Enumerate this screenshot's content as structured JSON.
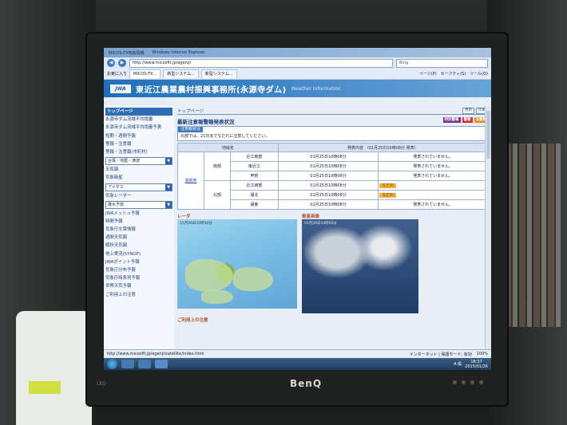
{
  "browser": {
    "tab_title": "MICOS-FX気象情報",
    "window_label": "Windows Internet Explorer",
    "url": "http://www.micosfit.jp/egenji/",
    "search_engine": "Bing",
    "favorites_label": "お気に入り",
    "fav_tabs": [
      "MICOS-FX...",
      "新型システム...",
      "新型システム..."
    ],
    "commands": [
      "ページ(P)",
      "セーフティ(S)",
      "ツール(O)"
    ]
  },
  "site": {
    "logo": "JWA",
    "title": "東近江農業農村振興事務所(永源寺ダム)",
    "subtitle": "Weather Information"
  },
  "sidebar": {
    "items": [
      {
        "label": "トップページ",
        "type": "head"
      },
      {
        "label": "永源寺ダム流域平均雨量",
        "type": "link"
      },
      {
        "label": "永源寺ダム流域平均雨量予測",
        "type": "link"
      },
      {
        "label": "短期・週間予報",
        "type": "link"
      },
      {
        "label": "警報・注意報",
        "type": "link"
      },
      {
        "label": "警報・注意報(市町村)",
        "type": "link"
      },
      {
        "label": "台風・地震・津波",
        "type": "select"
      },
      {
        "label": "天気図",
        "type": "link"
      },
      {
        "label": "気象衛星",
        "type": "link"
      },
      {
        "label": "アメダス",
        "type": "select"
      },
      {
        "label": "気象レーダー",
        "type": "link"
      },
      {
        "label": "降水予測",
        "type": "select"
      },
      {
        "label": "JWAメッシュ予報",
        "type": "link"
      },
      {
        "label": "時間予報",
        "type": "link"
      },
      {
        "label": "気象庁文章情報",
        "type": "link"
      },
      {
        "label": "週間天気図",
        "type": "link"
      },
      {
        "label": "解析天気図",
        "type": "link"
      },
      {
        "label": "地上実況(SYNOP)",
        "type": "link"
      },
      {
        "label": "JWAポイント予報",
        "type": "link"
      },
      {
        "label": "気象庁分布予報",
        "type": "link"
      },
      {
        "label": "気象庁時系列予報",
        "type": "link"
      },
      {
        "label": "世界天気予報",
        "type": "link"
      },
      {
        "label": "ご利用上の注意",
        "type": "link"
      }
    ]
  },
  "main": {
    "breadcrumb": "トップページ",
    "mini_buttons": [
      "更新",
      "印刷"
    ],
    "section_title": "最新注意報警報発表状況",
    "legend": [
      {
        "label": "特別警報",
        "color": "#7b2d8e"
      },
      {
        "label": "警報",
        "color": "#d8282f"
      },
      {
        "label": "注意報",
        "color": "#e08a1e"
      }
    ],
    "note_header": "注意報状況",
    "note_text": "北部では、21日までなだれに注意してください。",
    "table": {
      "col_area": "地域名",
      "col_content": "発表内容 （01月25日10時08分 発表）",
      "prefecture": "滋賀県",
      "rows": [
        {
          "region": "南部",
          "area": "近江南部",
          "time": "01月25日10時08分",
          "badge": "",
          "status": "発表されていません。"
        },
        {
          "region": "",
          "area": "東近江",
          "time": "01月25日10時08分",
          "badge": "",
          "status": "発表されていません。"
        },
        {
          "region": "",
          "area": "甲賀",
          "time": "01月25日10時08分",
          "badge": "",
          "status": "発表されていません。"
        },
        {
          "region": "北部",
          "area": "近江西部",
          "time": "01月25日10時08分",
          "badge": "なだれ",
          "status": ""
        },
        {
          "region": "",
          "area": "湖北",
          "time": "01月25日10時08分",
          "badge": "なだれ",
          "status": ""
        },
        {
          "region": "",
          "area": "湖東",
          "time": "01月25日10時08分",
          "badge": "",
          "status": "発表されていません。"
        }
      ]
    },
    "radar_title": "レーダ",
    "radar_time": "01月26日10時30分",
    "satellite_title": "衛星画像",
    "satellite_time": "01月26日10時00分",
    "caution": "ご利用上の注意"
  },
  "status": {
    "link": "http://www.micosfit.jp/egenji/satellite/index.html",
    "zone": "インターネット | 保護モード: 有効",
    "zoom": "100%"
  },
  "taskbar": {
    "time": "18:37",
    "date": "2015/01/26",
    "ime": "A 般"
  },
  "monitor": {
    "brand": "BenQ",
    "led_label": "LED"
  }
}
